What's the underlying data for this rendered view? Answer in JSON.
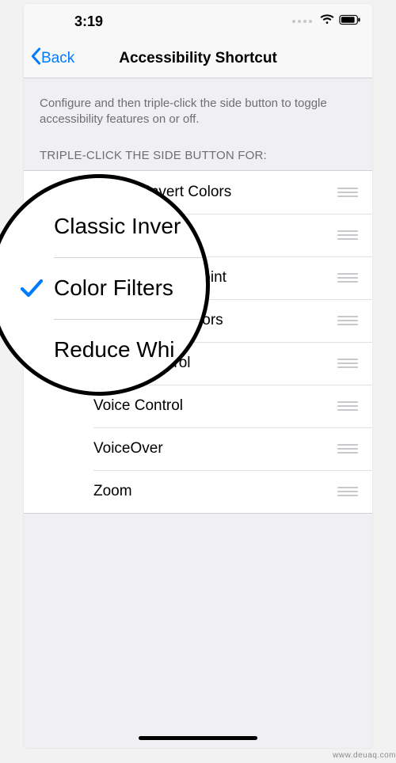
{
  "statusbar": {
    "time": "3:19"
  },
  "nav": {
    "back": "Back",
    "title": "Accessibility Shortcut"
  },
  "description": "Configure and then triple-click the side button to toggle accessibility features on or off.",
  "section_header": "TRIPLE-CLICK THE SIDE BUTTON FOR:",
  "items": [
    {
      "label": "Classic Invert Colors",
      "checked": false
    },
    {
      "label": "Color Filters",
      "checked": true
    },
    {
      "label": "Reduce White Point",
      "checked": false
    },
    {
      "label": "Smart Invert Colors",
      "checked": false
    },
    {
      "label": "Switch Control",
      "checked": false
    },
    {
      "label": "Voice Control",
      "checked": false
    },
    {
      "label": "VoiceOver",
      "checked": false
    },
    {
      "label": "Zoom",
      "checked": false
    }
  ],
  "magnifier": {
    "row0": "Classic Inver",
    "row1": "Color Filters",
    "row2": "Reduce Whi"
  },
  "watermark": "www.deuaq.com",
  "colors": {
    "tint": "#007aff"
  }
}
